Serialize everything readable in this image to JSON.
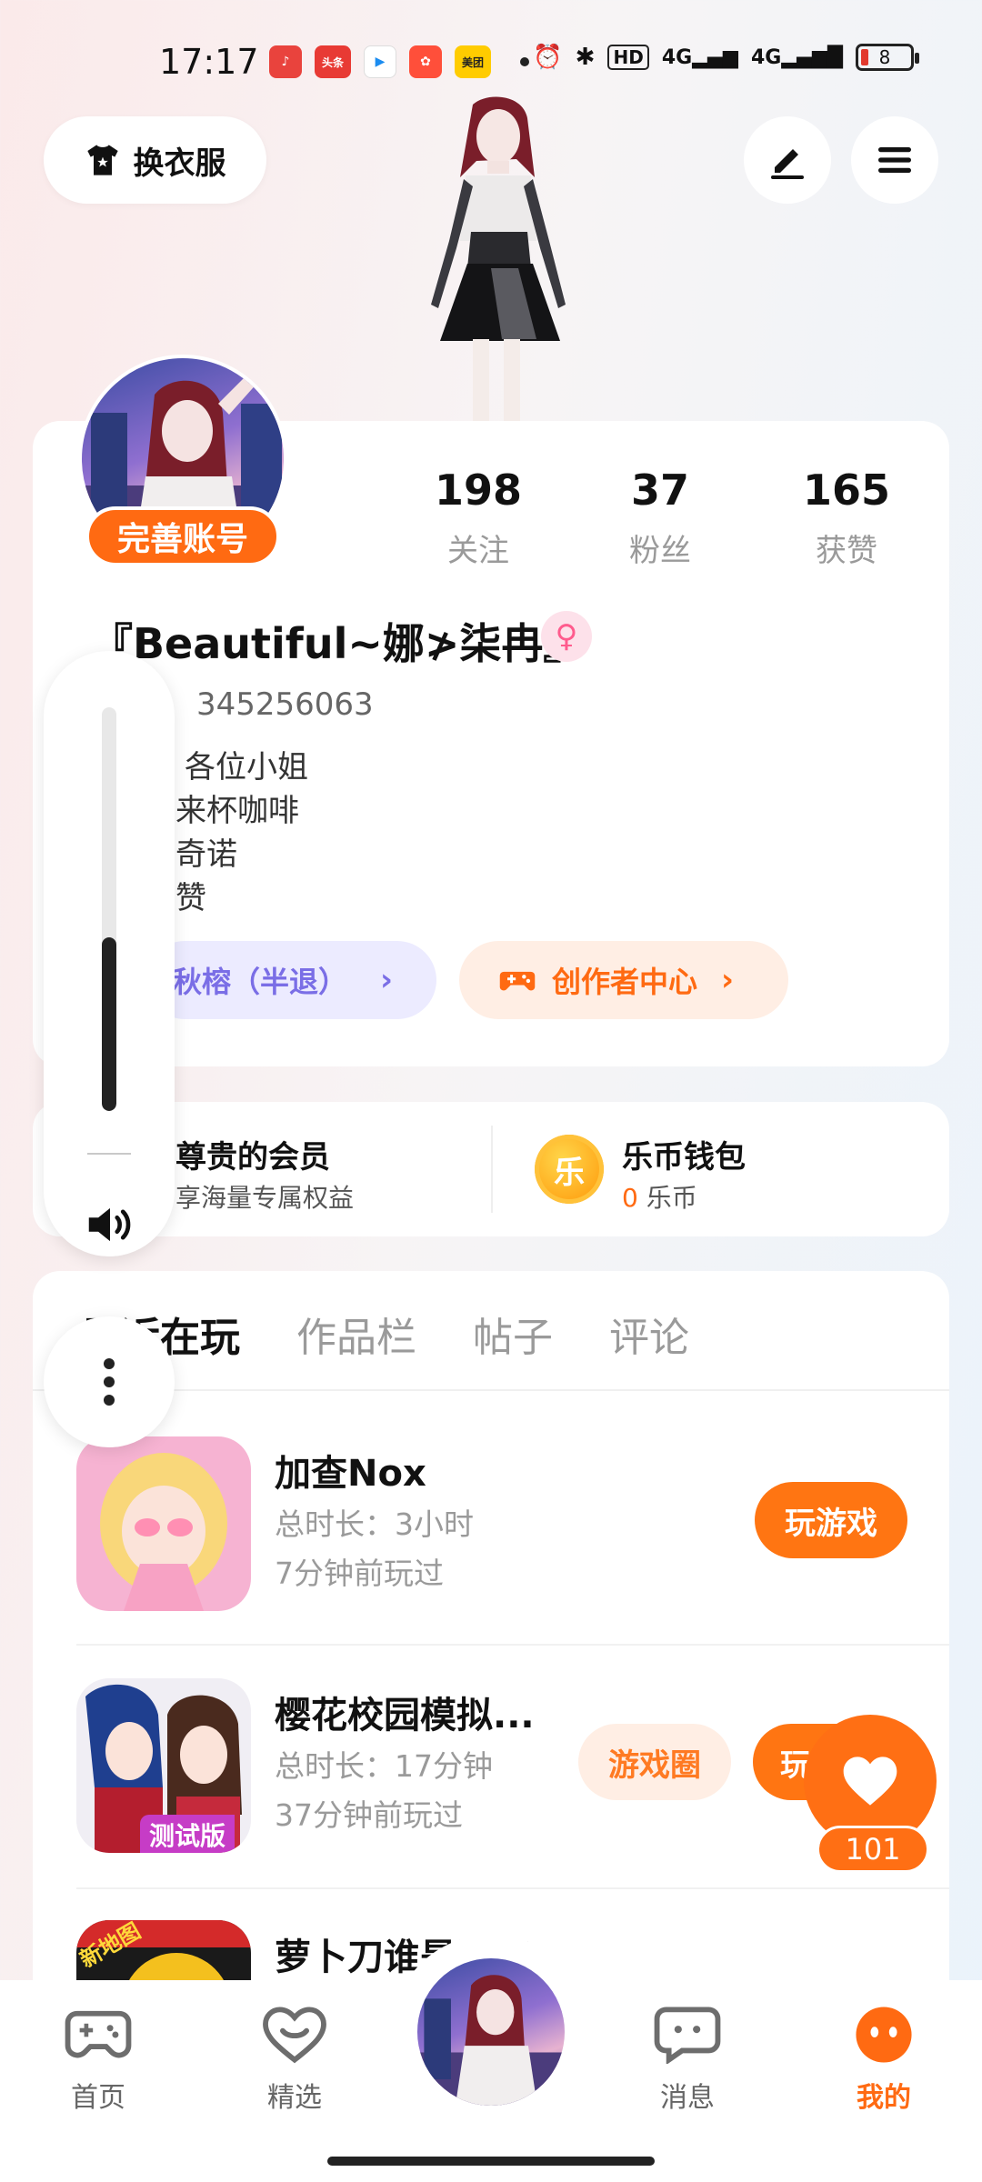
{
  "status_bar": {
    "time": "17:17",
    "apps": [
      {
        "icon": "music-app-icon",
        "color": "#e9433d",
        "text": "♪"
      },
      {
        "icon": "toutiao-app-icon",
        "color": "#e83a34",
        "text": "头条"
      },
      {
        "icon": "video-app-icon",
        "color": "#ffffff",
        "text": "▶"
      },
      {
        "icon": "kuaishou-app-icon",
        "color": "#ff4f3a",
        "text": "✿"
      },
      {
        "icon": "meituan-app-icon",
        "color": "#ffcc00",
        "text": "美团"
      }
    ],
    "network": "4G",
    "hd_label": "HD",
    "battery_level": "8"
  },
  "top_bar": {
    "outfit_label": "换衣服"
  },
  "profile": {
    "badge_label": "完善账号",
    "stats": [
      {
        "value": "198",
        "label": "关注"
      },
      {
        "value": "37",
        "label": "粉丝"
      },
      {
        "value": "165",
        "label": "获赞"
      }
    ],
    "nickname": "『Beautiful~娜≯柒冉』",
    "gender_symbol": "♀",
    "user_id": "345256063",
    "bio_lines": [
      "各位小姐",
      "来杯咖啡",
      "奇诺",
      "赞"
    ],
    "guild_label": "秋榕（半退）",
    "creator_label": "创作者中心"
  },
  "membership": {
    "title": "尊贵的会员",
    "subtitle": "享海量专属权益"
  },
  "wallet": {
    "coin_glyph": "乐",
    "title": "乐币钱包",
    "amount": "0",
    "unit": "乐币"
  },
  "tabs": [
    "最近在玩",
    "作品栏",
    "帖子",
    "评论"
  ],
  "games": [
    {
      "name": "加查Nox",
      "duration": "总时长：3小时",
      "last_played": "7分钟前玩过",
      "play_label": "玩游戏"
    },
    {
      "name": "樱花校园模拟...",
      "duration": "总时长：17分钟",
      "last_played": "37分钟前玩过",
      "circle_label": "游戏圈",
      "play_label": "玩游戏",
      "icon_badge": "测试版"
    },
    {
      "name": "萝卜刀谁是卧底",
      "icon_badge": "新地图"
    }
  ],
  "volume": {
    "level": 0.43
  },
  "like_fab": {
    "count": "101"
  },
  "bottom_nav": [
    {
      "label": "首页"
    },
    {
      "label": "精选"
    },
    {
      "label": "消息"
    },
    {
      "label": "我的"
    }
  ],
  "colors": {
    "accent": "#ff6a12",
    "guild": "#7a6ee6",
    "gender": "#ff5b8d"
  }
}
